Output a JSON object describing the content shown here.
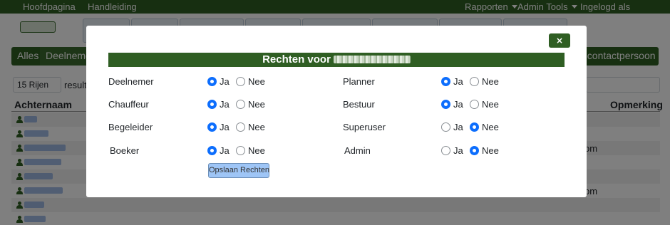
{
  "topbar": {
    "home": "Hoofdpagina",
    "manual": "Handleiding",
    "reports": "Rapporten",
    "admin_tools": "Admin Tools",
    "logged_in": "Ingelogd als"
  },
  "filters": {
    "all": "Alles",
    "participants": "Deelnemer",
    "new_contact": "uw contactpersoon"
  },
  "table_controls": {
    "rows_select": "15 Rijen",
    "result_text": "resulta"
  },
  "table": {
    "col_last_name": "Achternaam",
    "col_remark": "Opmerking",
    "remarks": [
      "",
      "",
      "om",
      "",
      "",
      "om",
      "",
      "",
      ""
    ]
  },
  "modal": {
    "close_label": "×",
    "title": "Rechten voor",
    "save_label": "Opslaan Rechten",
    "yes_label": "Ja",
    "no_label": "Nee",
    "permissions_left": [
      {
        "label": "Deelnemer",
        "value": "Ja"
      },
      {
        "label": "Chauffeur",
        "value": "Ja"
      },
      {
        "label": "Begeleider",
        "value": "Ja"
      },
      {
        "label": "Boeker",
        "value": "Ja"
      }
    ],
    "permissions_right": [
      {
        "label": "Planner",
        "value": "Ja"
      },
      {
        "label": "Bestuur",
        "value": "Ja"
      },
      {
        "label": "Superuser",
        "value": "Nee"
      },
      {
        "label": "Admin",
        "value": "Nee"
      }
    ]
  },
  "colors": {
    "brand_green": "#2f5e23",
    "radio_blue": "#0d6efd",
    "save_button": "#9ec5f6"
  }
}
